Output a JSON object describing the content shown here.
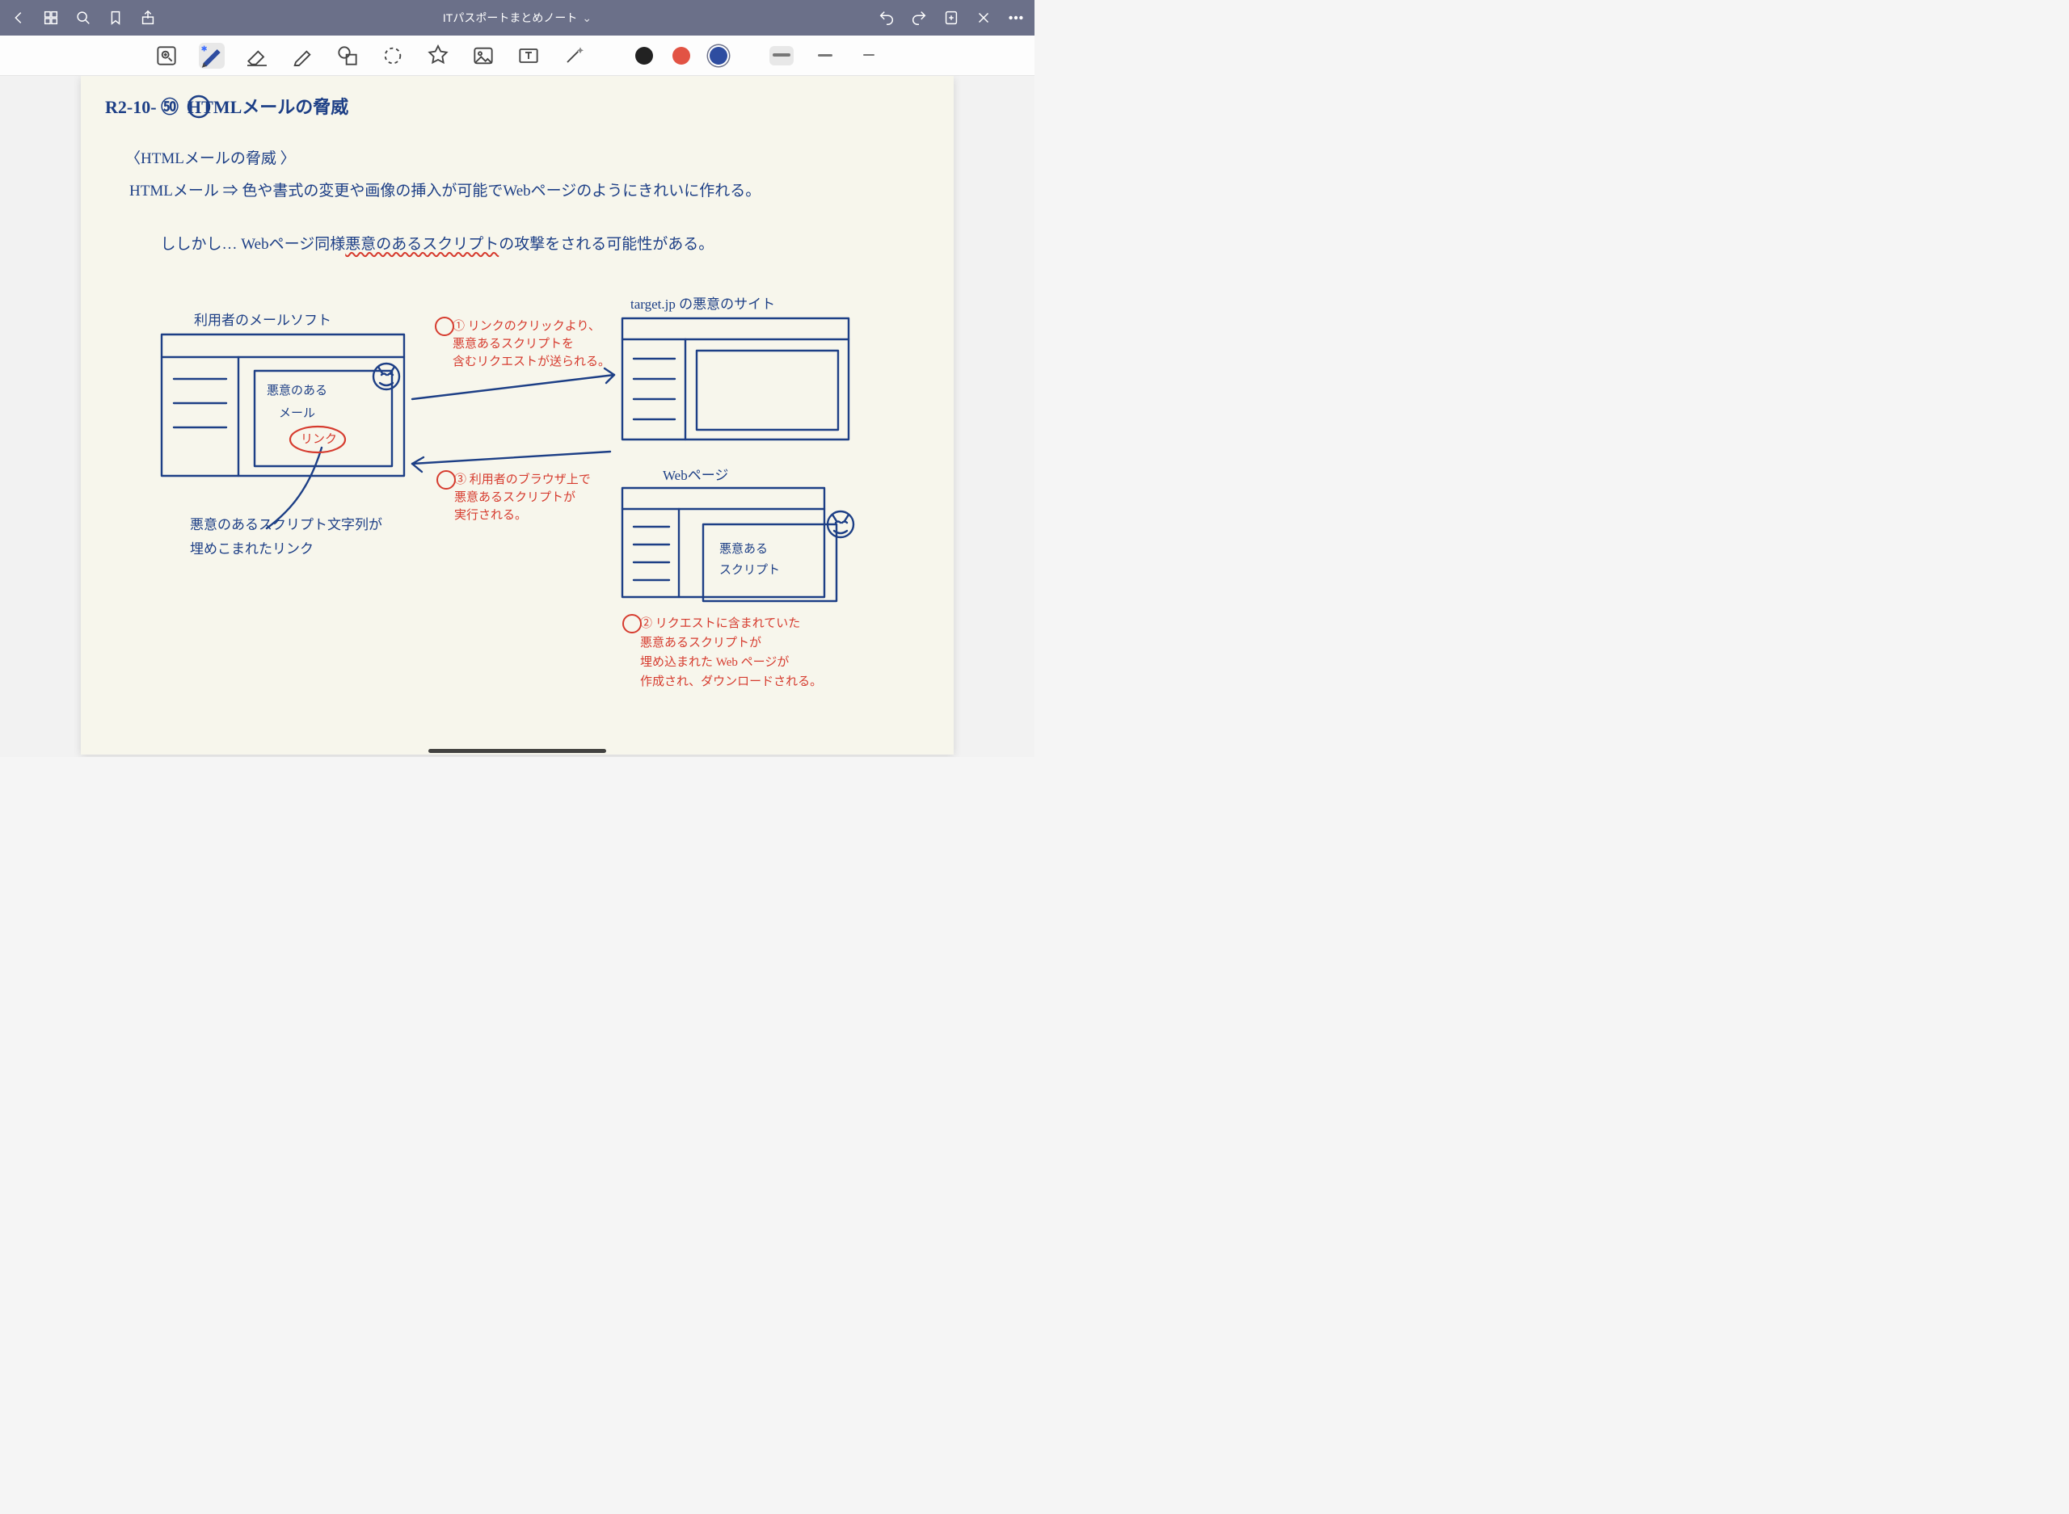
{
  "titlebar": {
    "title": "ITパスポートまとめノート",
    "chevron": "⌄"
  },
  "note": {
    "heading": "R2-10- ㊿  HTMLメールの脅威",
    "section_title": "〈HTMLメールの脅威 〉",
    "line1_a": "HTMLメール ⇒ 色や書式の変更や画像の挿入が可能でWebページのようにきれいに作れる。",
    "line2_a": "ししかし… Webページ同様",
    "line2_b": "悪意のあるスクリプト",
    "line2_c": "の攻撃をされる可能性がある。",
    "box_left_title": "利用者のメールソフト",
    "box_left_inner1": "悪意のある",
    "box_left_inner2": "メール",
    "box_left_inner3": "リンク",
    "box_left_caption1": "悪意のあるスクリプト文字列が",
    "box_left_caption2": "埋めこまれたリンク",
    "arrow1_line1": "① リンクのクリックより、",
    "arrow1_line2": "悪意あるスクリプトを",
    "arrow1_line3": "含むリクエストが送られる。",
    "arrow2_line1": "③ 利用者のブラウザ上で",
    "arrow2_line2": "悪意あるスクリプトが",
    "arrow2_line3": "実行される。",
    "box_right_title": "target.jp の悪意のサイト",
    "box_web_title": "Webページ",
    "box_web_inner1": "悪意ある",
    "box_web_inner2": "スクリプト",
    "step2_line1": "② リクエストに含まれていた",
    "step2_line2": "悪意あるスクリプトが",
    "step2_line3": "埋め込まれた Web ページが",
    "step2_line4": "作成され、ダウンロードされる。"
  },
  "colors": {
    "black": "#222222",
    "red": "#e25344",
    "blue": "#2e4da0"
  }
}
